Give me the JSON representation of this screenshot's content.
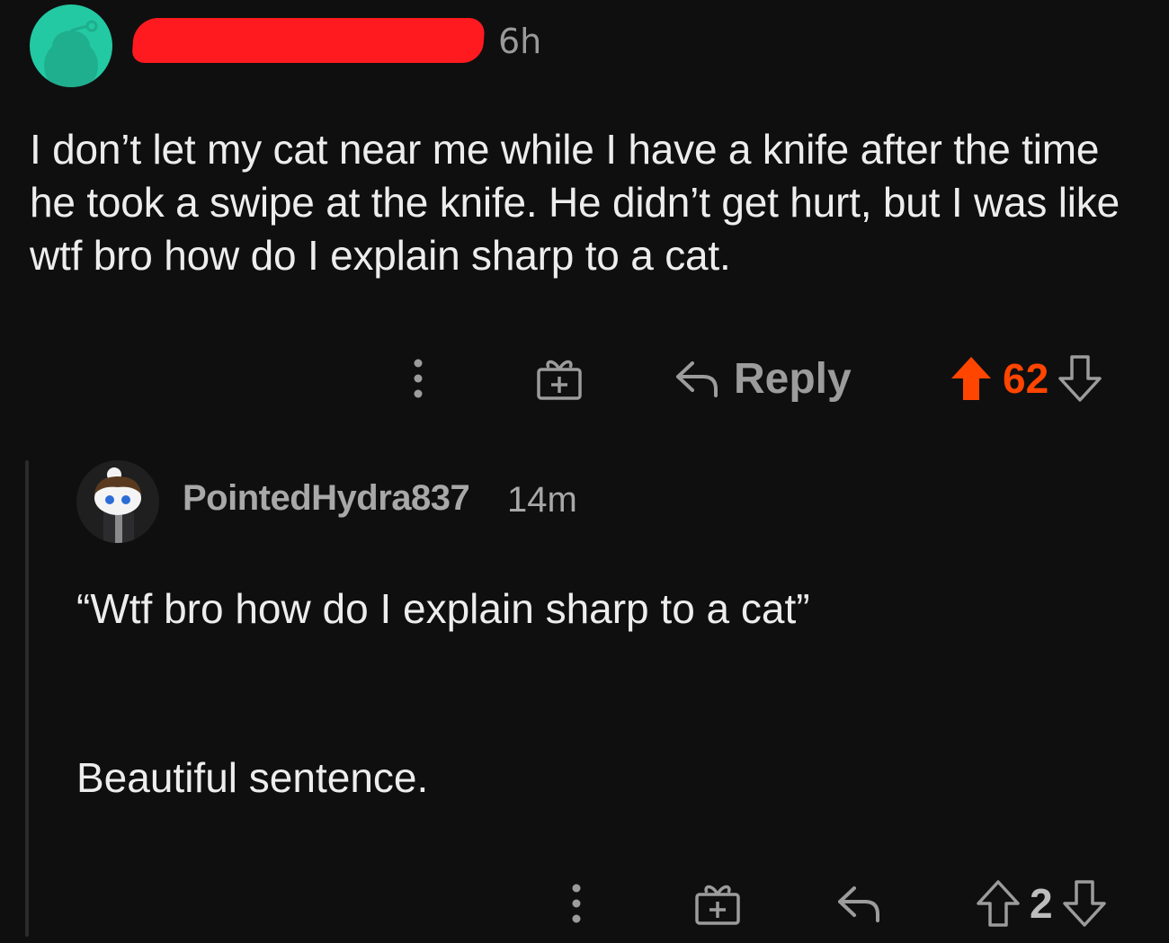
{
  "top_comment": {
    "time": "6h",
    "body": "I don’t let my cat near me while I have a knife after the time he took a swipe at the knife. He didn’t get hurt, but I was like wtf bro how do I explain sharp to a cat.",
    "actions": {
      "reply_label": "Reply",
      "vote_count": "62",
      "vote_state": "upvoted",
      "upvote_color": "#ff4500"
    }
  },
  "child_comment": {
    "username": "PointedHydra837",
    "time": "14m",
    "body_lines": [
      "“Wtf bro how do I explain sharp to a cat”",
      "Beautiful sentence."
    ],
    "actions": {
      "vote_count": "2",
      "vote_state": "none"
    }
  },
  "icons": [
    "more-vertical-icon",
    "gift-award-icon",
    "reply-arrow-icon",
    "upvote-icon",
    "downvote-icon",
    "snoo-avatar-icon"
  ],
  "colors": {
    "background": "#0f0f10",
    "avatar_top": "#23c9a3",
    "redaction": "#ff1a1f",
    "muted": "#9c9c9c"
  }
}
